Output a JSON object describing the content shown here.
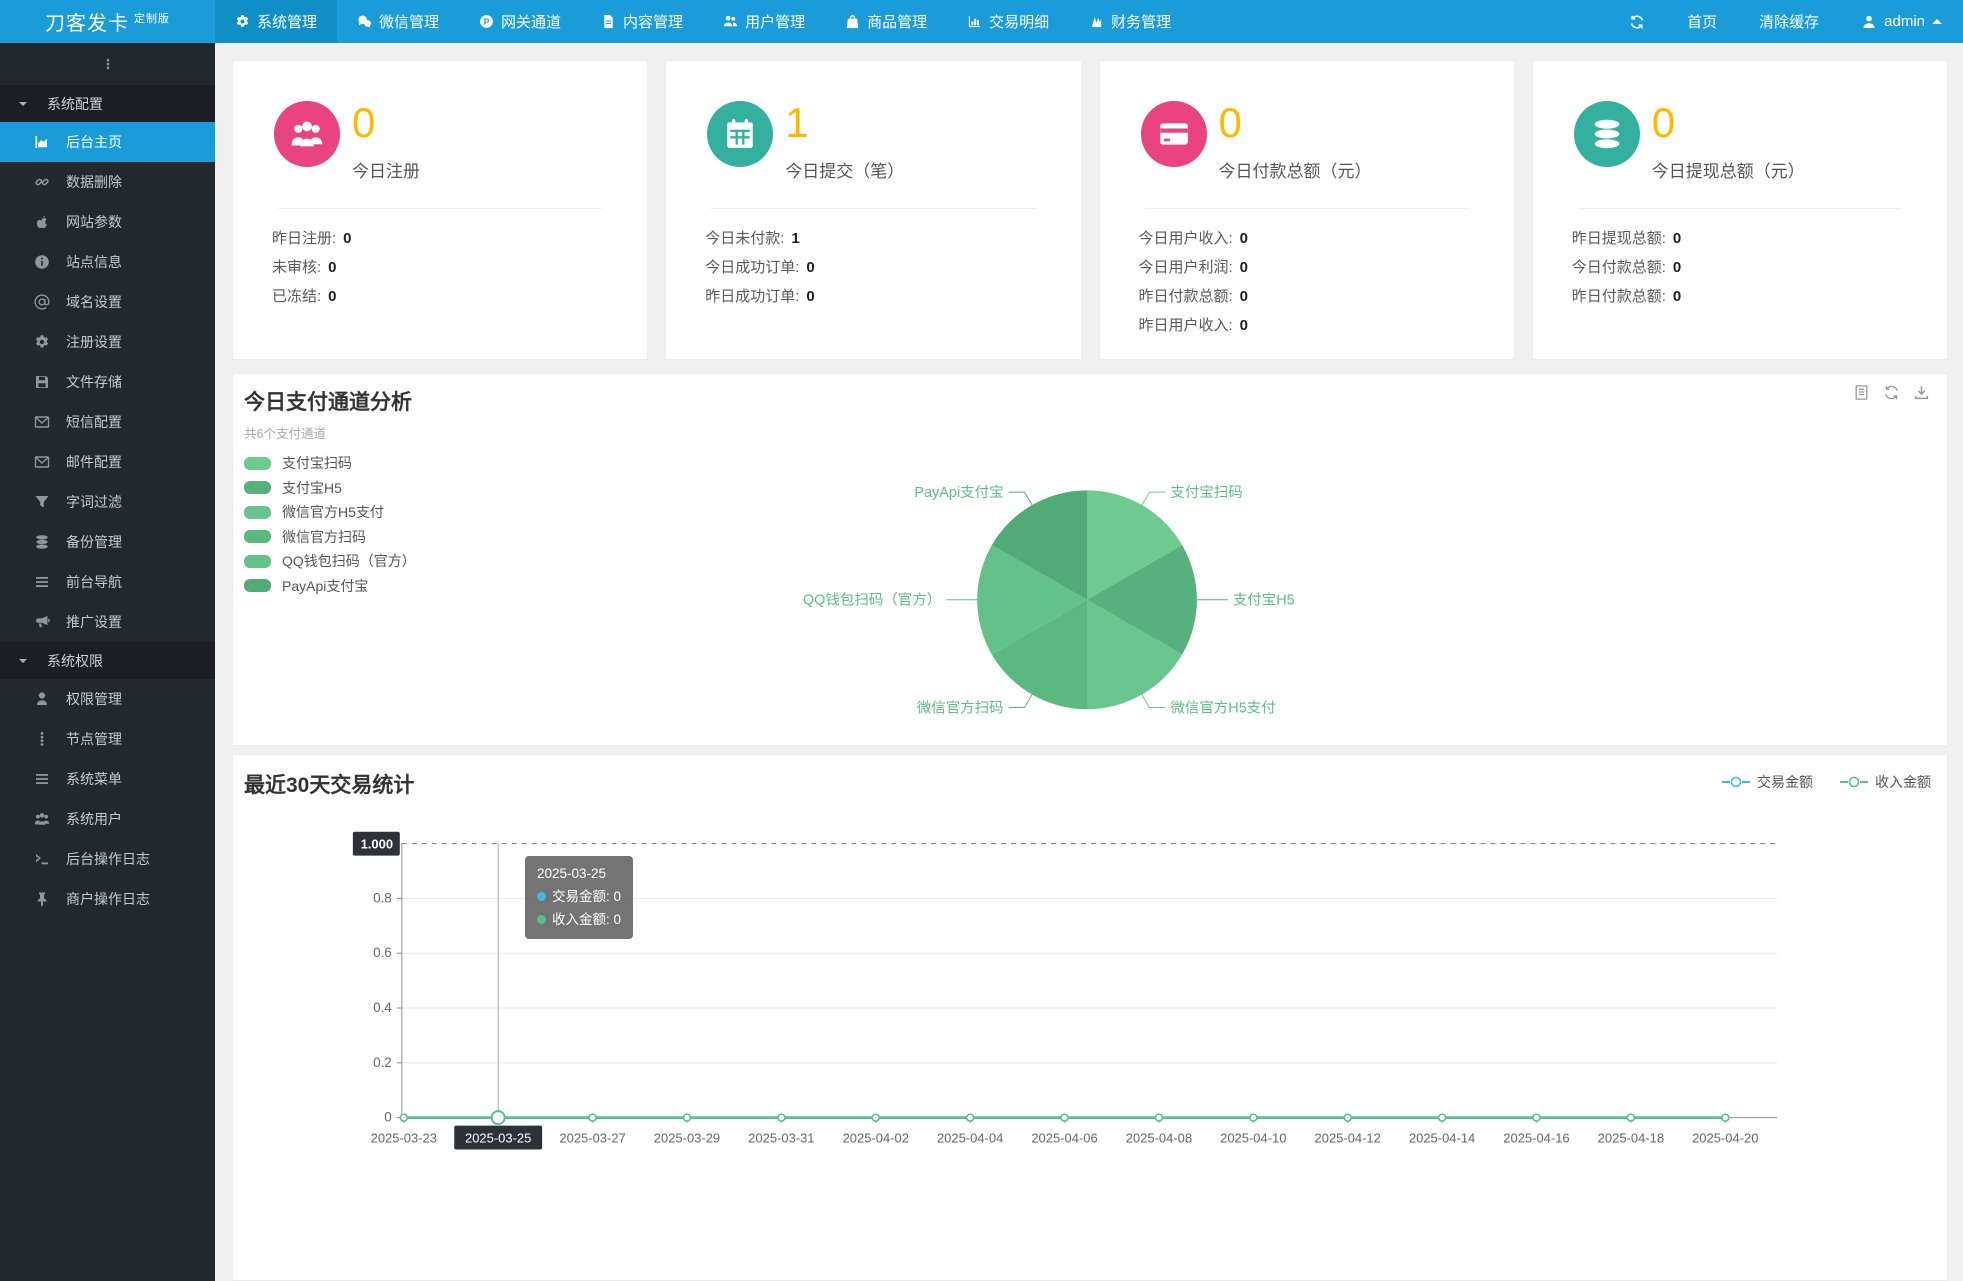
{
  "navbar": {
    "logo": "刀客发卡",
    "logo_badge": "定制版",
    "items": [
      {
        "label": "系统管理",
        "icon": "gear-icon",
        "active": true
      },
      {
        "label": "微信管理",
        "icon": "wechat-icon"
      },
      {
        "label": "网关通道",
        "icon": "gateway-icon"
      },
      {
        "label": "内容管理",
        "icon": "document-icon"
      },
      {
        "label": "用户管理",
        "icon": "user-group-icon"
      },
      {
        "label": "商品管理",
        "icon": "shop-icon"
      },
      {
        "label": "交易明细",
        "icon": "bar-chart-icon"
      },
      {
        "label": "财务管理",
        "icon": "finance-icon"
      }
    ],
    "right": {
      "home": "首页",
      "clear_cache": "清除缓存",
      "user": "admin"
    }
  },
  "sidebar": {
    "items": [
      {
        "cls": "side-group",
        "label": "系统配置"
      },
      {
        "cls": "side-item",
        "label": "后台主页",
        "icon": "area-chart-icon",
        "active": true
      },
      {
        "cls": "side-item",
        "label": "数据删除",
        "icon": "link-icon"
      },
      {
        "cls": "side-item",
        "label": "网站参数",
        "icon": "apple-icon"
      },
      {
        "cls": "side-item",
        "label": "站点信息",
        "icon": "info-icon"
      },
      {
        "cls": "side-item",
        "label": "域名设置",
        "icon": "at-icon"
      },
      {
        "cls": "side-item",
        "label": "注册设置",
        "icon": "gear-icon"
      },
      {
        "cls": "side-item",
        "label": "文件存储",
        "icon": "save-icon"
      },
      {
        "cls": "side-item",
        "label": "短信配置",
        "icon": "envelope-icon"
      },
      {
        "cls": "side-item",
        "label": "邮件配置",
        "icon": "envelope-icon"
      },
      {
        "cls": "side-item",
        "label": "字词过滤",
        "icon": "filter-icon"
      },
      {
        "cls": "side-item",
        "label": "备份管理",
        "icon": "database-icon"
      },
      {
        "cls": "side-item",
        "label": "前台导航",
        "icon": "menu-icon"
      },
      {
        "cls": "side-item",
        "label": "推广设置",
        "icon": "megaphone-icon"
      },
      {
        "cls": "side-group",
        "label": "系统权限"
      },
      {
        "cls": "side-item",
        "label": "权限管理",
        "icon": "user-secret-icon"
      },
      {
        "cls": "side-item",
        "label": "节点管理",
        "icon": "dots-icon"
      },
      {
        "cls": "side-item",
        "label": "系统菜单",
        "icon": "menu-icon"
      },
      {
        "cls": "side-item",
        "label": "系统用户",
        "icon": "users-icon"
      },
      {
        "cls": "side-item",
        "label": "后台操作日志",
        "icon": "terminal-icon"
      },
      {
        "cls": "side-item",
        "label": "商户操作日志",
        "icon": "pin-icon"
      }
    ]
  },
  "stat_cards": [
    {
      "icon": "users-icon",
      "icon_color": "#e9447f",
      "value": "0",
      "label": "今日注册",
      "rows": [
        {
          "label": "昨日注册:",
          "value": "0"
        },
        {
          "label": "未审核:",
          "value": "0"
        },
        {
          "label": "已冻结:",
          "value": "0"
        }
      ]
    },
    {
      "icon": "calendar-icon",
      "icon_color": "#34b19e",
      "value": "1",
      "label": "今日提交（笔）",
      "rows": [
        {
          "label": "今日未付款:",
          "value": "1"
        },
        {
          "label": "今日成功订单:",
          "value": "0"
        },
        {
          "label": "昨日成功订单:",
          "value": "0"
        }
      ]
    },
    {
      "icon": "credit-card-icon",
      "icon_color": "#e9447f",
      "value": "0",
      "label": "今日付款总额（元）",
      "rows": [
        {
          "label": "今日用户收入:",
          "value": "0"
        },
        {
          "label": "今日用户利润:",
          "value": "0"
        },
        {
          "label": "昨日付款总额:",
          "value": "0"
        },
        {
          "label": "昨日用户收入:",
          "value": "0"
        }
      ]
    },
    {
      "icon": "coins-icon",
      "icon_color": "#34b19e",
      "value": "0",
      "label": "今日提现总额（元）",
      "rows": [
        {
          "label": "昨日提现总额:",
          "value": "0"
        },
        {
          "label": "今日付款总额:",
          "value": "0"
        },
        {
          "label": "昨日付款总额:",
          "value": "0"
        }
      ]
    }
  ],
  "pie_section": {
    "title": "今日支付通道分析",
    "subtitle": "共6个支付通道",
    "legend": [
      {
        "label": "支付宝扫码",
        "color": "#6ecb90"
      },
      {
        "label": "支付宝H5",
        "color": "#57b17c"
      },
      {
        "label": "微信官方H5支付",
        "color": "#68c58b"
      },
      {
        "label": "微信官方扫码",
        "color": "#5bb980"
      },
      {
        "label": "QQ钱包扫码（官方）",
        "color": "#63c287"
      },
      {
        "label": "PayApi支付宝",
        "color": "#52ab76"
      }
    ]
  },
  "line_section": {
    "title": "最近30天交易统计",
    "legend": [
      {
        "label": "交易金额",
        "color": "#41b9ec"
      },
      {
        "label": "收入金额",
        "color": "#58c08a"
      }
    ],
    "tooltip": {
      "date": "2025-03-25",
      "rows": [
        {
          "label": "交易金额:",
          "value": "0",
          "color": "#41b9ec"
        },
        {
          "label": "收入金额:",
          "value": "0",
          "color": "#58c08a"
        }
      ]
    },
    "y_pointer_label": "1.000",
    "x_pointer_label": "2025-03-25"
  },
  "chart_data": [
    {
      "type": "pie",
      "title": "今日支付通道分析",
      "subtitle": "共6个支付通道",
      "categories": [
        "支付宝扫码",
        "支付宝H5",
        "微信官方H5支付",
        "微信官方扫码",
        "QQ钱包扫码（官方）",
        "PayApi支付宝"
      ],
      "values": [
        1,
        1,
        1,
        1,
        1,
        1
      ],
      "colors": [
        "#6ecb90",
        "#57b17c",
        "#68c58b",
        "#5bb980",
        "#63c287",
        "#52ab76"
      ],
      "label_color": "#5abf85",
      "legend_position": "left"
    },
    {
      "type": "line",
      "title": "最近30天交易统计",
      "x": [
        "2025-03-23",
        "2025-03-25",
        "2025-03-27",
        "2025-03-29",
        "2025-03-31",
        "2025-04-02",
        "2025-04-04",
        "2025-04-06",
        "2025-04-08",
        "2025-04-10",
        "2025-04-12",
        "2025-04-14",
        "2025-04-16",
        "2025-04-18",
        "2025-04-20"
      ],
      "series": [
        {
          "name": "交易金额",
          "color": "#41b9ec",
          "values": [
            0,
            0,
            0,
            0,
            0,
            0,
            0,
            0,
            0,
            0,
            0,
            0,
            0,
            0,
            0
          ]
        },
        {
          "name": "收入金额",
          "color": "#58c08a",
          "values": [
            0,
            0,
            0,
            0,
            0,
            0,
            0,
            0,
            0,
            0,
            0,
            0,
            0,
            0,
            0
          ]
        }
      ],
      "ylim": [
        0,
        1
      ],
      "yticks": [
        0,
        0.2,
        0.4,
        0.6,
        0.8
      ],
      "y_pointer": "1.000",
      "highlighted_x": "2025-03-25",
      "grid": true,
      "legend_position": "top-right"
    }
  ]
}
